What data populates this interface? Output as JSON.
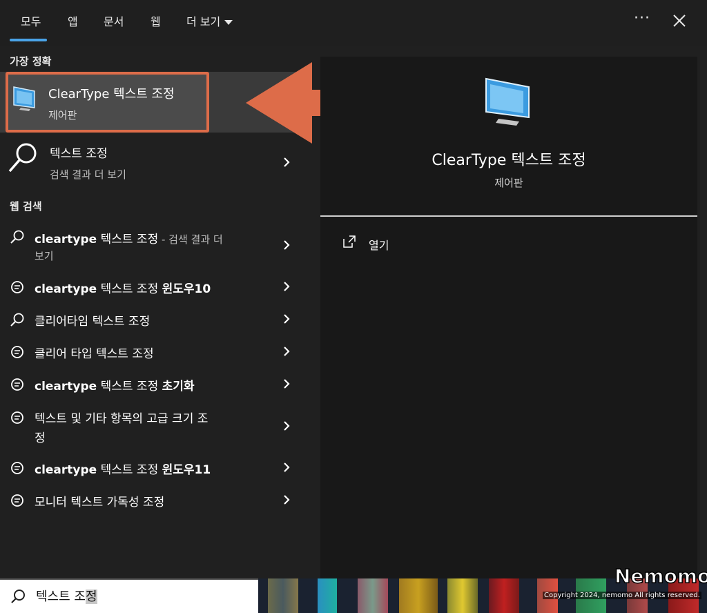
{
  "tabs": [
    {
      "label": "모두"
    },
    {
      "label": "앱"
    },
    {
      "label": "문서"
    },
    {
      "label": "웹"
    },
    {
      "label": "더 보기"
    }
  ],
  "header": {
    "more_options_icon": "ellipsis-icon",
    "close_icon": "close-icon"
  },
  "sections": {
    "best_match": "가장 정확",
    "web_search": "웹 검색"
  },
  "best_match": {
    "title": "ClearType 텍스트 조정",
    "subtitle": "제어판",
    "icon": "monitor-icon"
  },
  "search_results": {
    "title": "텍스트 조정",
    "subtitle": "검색 결과 더 보기",
    "icon": "search-icon"
  },
  "web_results": [
    {
      "bold": "cleartype",
      "text": " 텍스트 조정",
      "suffix": " - 검색 결과 더",
      "line2": "보기",
      "icon": "search-icon"
    },
    {
      "bold": "cleartype",
      "text": " 텍스트 조정 ",
      "bold2": "윈도우10",
      "icon": "chat-icon"
    },
    {
      "text": "클리어타임 텍스트 조정",
      "icon": "search-icon"
    },
    {
      "text": "클리어 타입 텍스트 조정",
      "icon": "chat-icon"
    },
    {
      "bold": "cleartype",
      "text": " 텍스트 조정 ",
      "bold2": "초기화",
      "icon": "chat-icon"
    },
    {
      "text": "텍스트 및 기타 항목의 고급 크기 조",
      "line2": "정",
      "icon": "chat-icon"
    },
    {
      "bold": "cleartype",
      "text": " 텍스트 조정 ",
      "bold2": "윈도우11",
      "icon": "chat-icon"
    },
    {
      "text": "모니터 텍스트 가독성 조정",
      "icon": "chat-icon"
    }
  ],
  "preview": {
    "title": "ClearType 텍스트 조정",
    "subtitle": "제어판",
    "open_label": "열기"
  },
  "search": {
    "typed": "텍스트 조",
    "selected": "정"
  },
  "watermark": {
    "brand": "Nemomo",
    "copyright": "Copyright 2024, nemomo All rights reserved."
  },
  "colors": {
    "highlight_border": "#dd6c49",
    "arrow": "#dd6c49",
    "accent": "#4aa3e8"
  }
}
